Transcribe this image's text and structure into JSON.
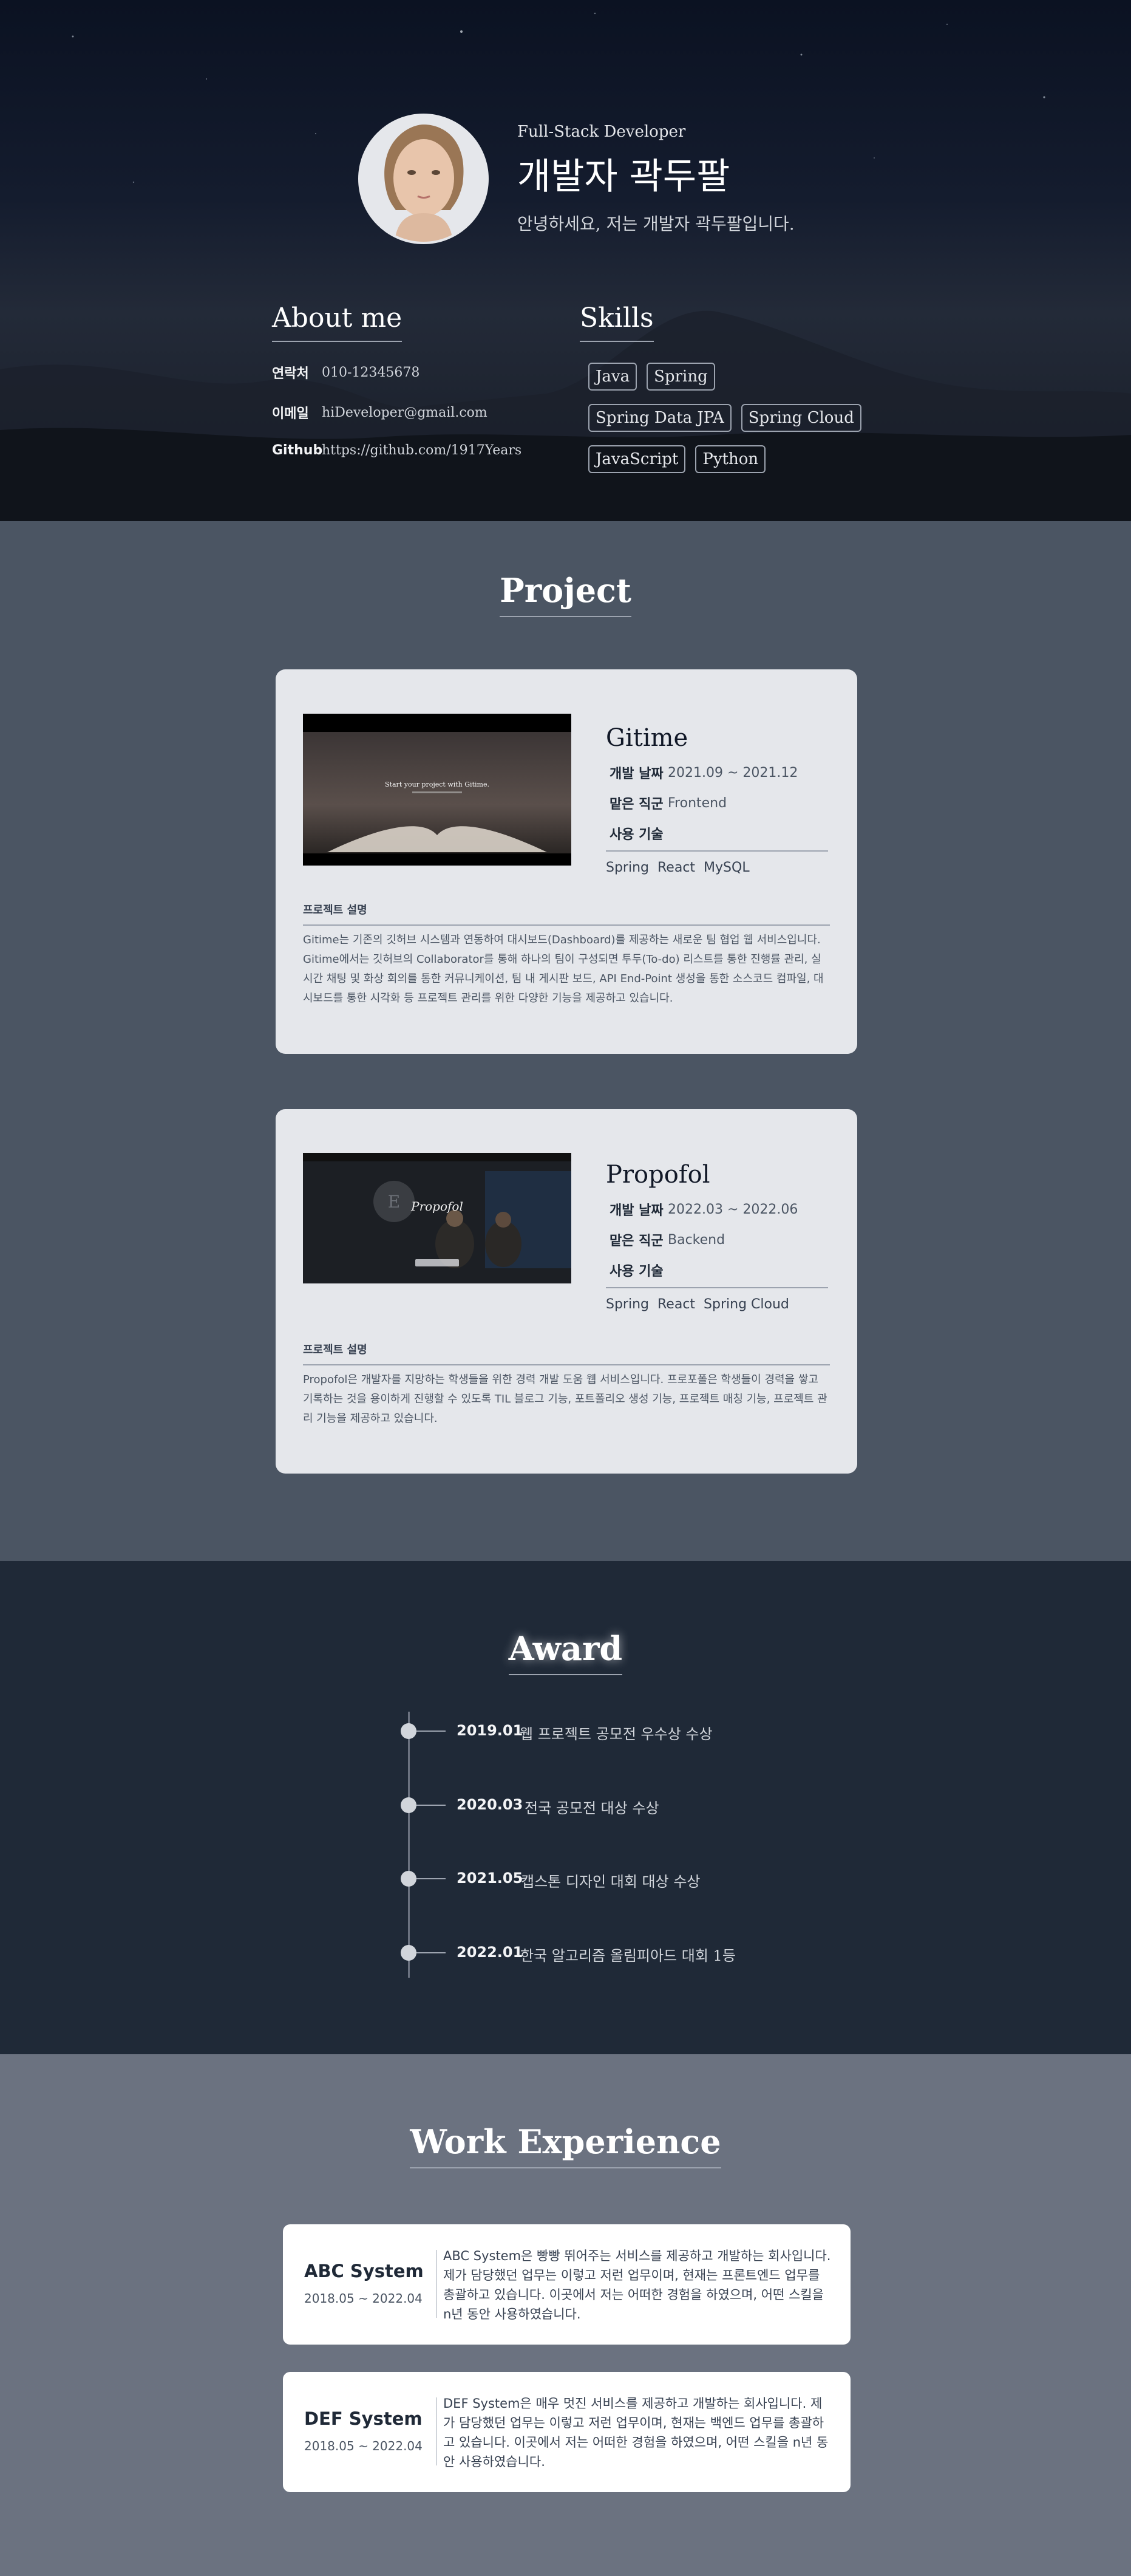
{
  "hero": {
    "role": "Full-Stack Developer",
    "name": "개발자 곽두팔",
    "greeting": "안녕하세요, 저는 개발자 곽두팔입니다."
  },
  "about": {
    "title": "About me",
    "rows": [
      {
        "key": "연락처",
        "value": "010-12345678"
      },
      {
        "key": "이메일",
        "value": "hiDeveloper@gmail.com"
      },
      {
        "key": "Github",
        "value": "https://github.com/1917Years"
      }
    ]
  },
  "skills": {
    "title": "Skills",
    "items": [
      "Java",
      "Spring",
      "Spring Data JPA",
      "Spring Cloud",
      "JavaScript",
      "Python"
    ]
  },
  "projects": {
    "title": "Project",
    "items": [
      {
        "name": "Gitime",
        "date_label": "개발 날짜",
        "date": "2021.09 ~ 2021.12",
        "role_label": "맡은 직군",
        "role": "Frontend",
        "tech_label": "사용 기술",
        "tech": [
          "Spring",
          "React",
          "MySQL"
        ],
        "desc_label": "프로젝트 설명",
        "desc": "Gitime는 기존의 깃허브 시스템과 연동하여 대시보드(Dashboard)를 제공하는 새로운 팀 협업 웹 서비스입니다. Gitime에서는 깃허브의 Collaborator를 통해 하나의 팀이 구성되면 투두(To-do) 리스트를 통한 진행률 관리, 실시간 채팅 및 화상 회의를 통한 커뮤니케이션, 팀 내 게시판 보드, API End-Point 생성을 통한 소스코드 컴파일, 대시보드를 통한 시각화 등 프로젝트 관리를 위한 다양한 기능을 제공하고 있습니다.",
        "shot_text": "Start your project with Gitime."
      },
      {
        "name": "Propofol",
        "date_label": "개발 날짜",
        "date": "2022.03 ~ 2022.06",
        "role_label": "맡은 직군",
        "role": "Backend",
        "tech_label": "사용 기술",
        "tech": [
          "Spring",
          "React",
          "Spring Cloud"
        ],
        "desc_label": "프로젝트 설명",
        "desc": "Propofol은 개발자를 지망하는 학생들을 위한 경력 개발 도움 웹 서비스입니다. 프로포폴은 학생들이 경력을 쌓고 기록하는 것을 용이하게 진행할 수 있도록 TIL 블로그 기능, 포트폴리오 생성 기능, 프로젝트 매칭 기능, 프로젝트 관리 기능을 제공하고 있습니다.",
        "shot_text": "Propofol"
      }
    ]
  },
  "awards": {
    "title": "Award",
    "items": [
      {
        "date": "2019.01",
        "name": "웹 프로젝트 공모전 우수상 수상"
      },
      {
        "date": "2020.03",
        "name": "전국 공모전 대상 수상"
      },
      {
        "date": "2021.05",
        "name": "캡스톤 디자인 대회 대상 수상"
      },
      {
        "date": "2022.01",
        "name": "한국 알고리즘 올림피아드 대회 1등"
      }
    ]
  },
  "work": {
    "title": "Work Experience",
    "items": [
      {
        "name": "ABC System",
        "period": "2018.05 ~ 2022.04",
        "desc": "ABC System은 빵빵 뛰어주는 서비스를 제공하고 개발하는 회사입니다. 제가 담당했던 업무는 이렇고 저런 업무이며, 현재는 프론트엔드 업무를 총괄하고 있습니다. 이곳에서 저는 어떠한 경험을 하였으며, 어떤 스킬을 n년 동안 사용하였습니다."
      },
      {
        "name": "DEF System",
        "period": "2018.05 ~ 2022.04",
        "desc": "DEF System은 매우 멋진 서비스를 제공하고 개발하는 회사입니다. 제가 담당했던 업무는 이렇고 저런 업무이며, 현재는 백엔드 업무를 총괄하고 있습니다. 이곳에서 저는 어떠한 경험을 하였으며, 어떤 스킬을 n년 동안 사용하였습니다."
      }
    ]
  }
}
